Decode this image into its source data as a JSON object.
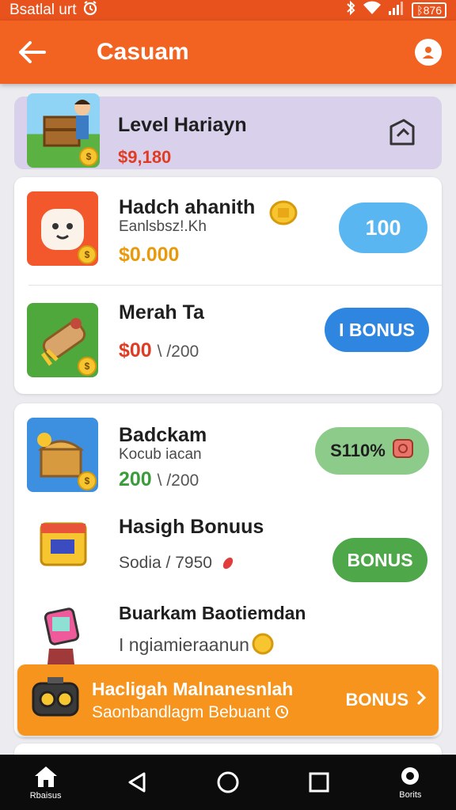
{
  "status_bar": {
    "left_text": "Bsatlal urt",
    "battery": "ᛒ876"
  },
  "app_bar": {
    "title": "Casuam"
  },
  "top_card": {
    "title": "Level Hariayn",
    "price": "$9,180",
    "price_color": "#e03c23"
  },
  "rows": [
    {
      "title": "Hadch ahanith",
      "subtitle": "Eanlsbsz!.Kh",
      "price": "$0.000",
      "price_suffix": "",
      "price_color": "#e89a0c",
      "button": "100"
    },
    {
      "title": "Merah Ta",
      "subtitle": "",
      "price": "$00",
      "price_suffix": "\\ /200",
      "price_color": "#e03c23",
      "button": "I BONUS"
    },
    {
      "title": "Badckam",
      "subtitle": "Kocub iacan",
      "price": "200",
      "price_suffix": "\\ /200",
      "price_color": "#3a9c3a",
      "button": "S110%"
    },
    {
      "title": "Hasigh Bonuus",
      "subtitle": "Sodia / 7950",
      "price": "",
      "price_suffix": "",
      "price_color": "#1f1f1f",
      "button": "BONUS"
    },
    {
      "title": "Buarkam Baotiemdan",
      "subtitle": "I ngiamieraanun",
      "price": "",
      "price_suffix": "",
      "price_color": "#1f1f1f",
      "button": ""
    }
  ],
  "promo": {
    "line1": "Hacligah Malnanesnlah",
    "line2": "Saonbandlagm Bebuant",
    "button": "BONUS"
  },
  "nav": {
    "home_label": "Rbaisus",
    "profile_label": "Borits"
  },
  "colors": {
    "brand": "#f26322",
    "promo": "#f7941d"
  }
}
